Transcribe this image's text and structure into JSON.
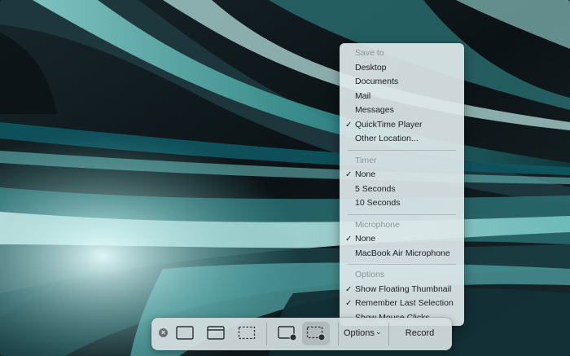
{
  "menu": {
    "sections": [
      {
        "header": "Save to",
        "items": [
          {
            "label": "Desktop",
            "checked": false
          },
          {
            "label": "Documents",
            "checked": false
          },
          {
            "label": "Mail",
            "checked": false
          },
          {
            "label": "Messages",
            "checked": false
          },
          {
            "label": "QuickTime Player",
            "checked": true
          },
          {
            "label": "Other Location...",
            "checked": false
          }
        ]
      },
      {
        "header": "Timer",
        "items": [
          {
            "label": "None",
            "checked": true
          },
          {
            "label": "5 Seconds",
            "checked": false
          },
          {
            "label": "10 Seconds",
            "checked": false
          }
        ]
      },
      {
        "header": "Microphone",
        "items": [
          {
            "label": "None",
            "checked": true
          },
          {
            "label": "MacBook Air Microphone",
            "checked": false
          }
        ]
      },
      {
        "header": "Options",
        "items": [
          {
            "label": "Show Floating Thumbnail",
            "checked": true
          },
          {
            "label": "Remember Last Selection",
            "checked": true
          },
          {
            "label": "Show Mouse Clicks",
            "checked": false
          }
        ]
      }
    ],
    "check_glyph": "✓"
  },
  "toolbar": {
    "close_glyph": "×",
    "options_label": "Options",
    "options_chevron": "⌄",
    "record_label": "Record",
    "tools": [
      {
        "icon": "capture-entire-screen-icon",
        "selected": false
      },
      {
        "icon": "capture-selected-window-icon",
        "selected": false
      },
      {
        "icon": "capture-selected-portion-icon",
        "selected": false
      },
      {
        "icon": "record-entire-screen-icon",
        "selected": false
      },
      {
        "icon": "record-selected-portion-icon",
        "selected": true
      }
    ]
  },
  "colors": {
    "menu_bg": "#dee8ea",
    "header_text": "#8d9598",
    "wallpaper_dark": "#0d1418",
    "wallpaper_teal": "#5fb5b5"
  }
}
